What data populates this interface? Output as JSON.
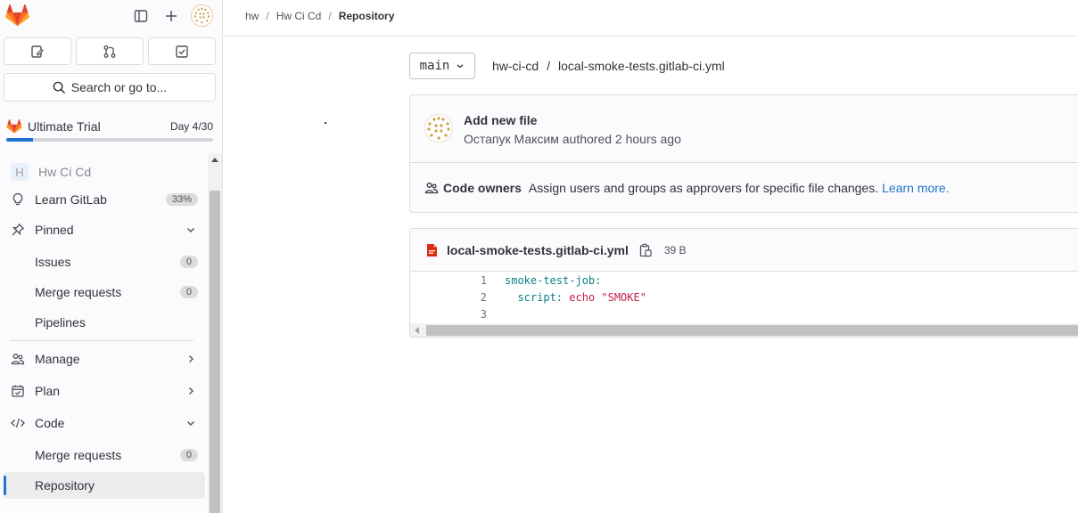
{
  "sidebar": {
    "search_label": "Search or go to...",
    "trial": {
      "name": "Ultimate Trial",
      "day": "Day 4/30",
      "progress": 0.13
    },
    "project": {
      "badge": "H",
      "name": "Hw Ci Cd"
    },
    "items": {
      "learn": {
        "label": "Learn GitLab",
        "count": "33%"
      },
      "pinned": {
        "label": "Pinned"
      },
      "pinned_issues": {
        "label": "Issues",
        "count": "0"
      },
      "pinned_mrs": {
        "label": "Merge requests",
        "count": "0"
      },
      "pinned_pipelines": {
        "label": "Pipelines"
      },
      "manage": {
        "label": "Manage"
      },
      "plan": {
        "label": "Plan"
      },
      "code": {
        "label": "Code"
      },
      "code_mrs": {
        "label": "Merge requests",
        "count": "0"
      },
      "code_repository": {
        "label": "Repository"
      }
    }
  },
  "breadcrumb": [
    "hw",
    "Hw Ci Cd",
    "Repository"
  ],
  "breadcrumb_sep": "/",
  "repo": {
    "branch": "main",
    "path_root": "hw-ci-cd",
    "path_sep": "/",
    "path_file": "local-smoke-tests.gitlab-ci.yml"
  },
  "commit": {
    "title": "Add new file",
    "author": "Остапук Максим",
    "authored": "authored 2 hours ago"
  },
  "code_owners": {
    "label": "Code owners",
    "text": "Assign users and groups as approvers for specific file changes.",
    "link": "Learn more."
  },
  "file": {
    "name": "local-smoke-tests.gitlab-ci.yml",
    "size": "39 B",
    "lines": [
      {
        "num": "1",
        "key": "smoke-test-job:",
        "value": ""
      },
      {
        "num": "2",
        "key": "  script:",
        "value": " echo \"SMOKE\""
      },
      {
        "num": "3",
        "key": "",
        "value": ""
      }
    ]
  },
  "colors": {
    "accent": "#1f75cb",
    "tanuki": "#e24329",
    "code_key": "#0b7f84",
    "code_str": "#c91c48"
  }
}
